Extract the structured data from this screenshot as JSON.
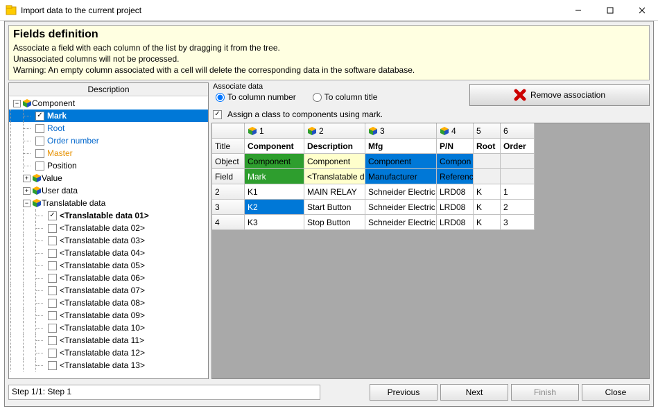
{
  "window": {
    "title": "Import data to the current project"
  },
  "instructions": {
    "heading": "Fields definition",
    "line1": "Associate a field with each column of the list by dragging it from the tree.",
    "line2": "Unassociated columns will not be processed.",
    "line3": "Warning: An empty column associated with a cell will delete the corresponding data in the software database."
  },
  "tree": {
    "header": "Description",
    "root": "Component",
    "mark": "Mark",
    "root_field": "Root",
    "order": "Order number",
    "master": "Master",
    "position": "Position",
    "value": "Value",
    "user_data": "User data",
    "translatable": "Translatable data",
    "td01": "<Translatable data 01>",
    "td02": "<Translatable data 02>",
    "td03": "<Translatable data 03>",
    "td04": "<Translatable data 04>",
    "td05": "<Translatable data 05>",
    "td06": "<Translatable data 06>",
    "td07": "<Translatable data 07>",
    "td08": "<Translatable data 08>",
    "td09": "<Translatable data 09>",
    "td10": "<Translatable data 10>",
    "td11": "<Translatable data 11>",
    "td12": "<Translatable data 12>",
    "td13": "<Translatable data 13>"
  },
  "associate": {
    "legend": "Associate data",
    "col_number": "To column number",
    "col_title": "To column title",
    "remove": "Remove association",
    "assign": "Assign a class to components using mark."
  },
  "grid": {
    "col1": "1",
    "col2": "2",
    "col3": "3",
    "col4": "4",
    "col5": "5",
    "col6": "6",
    "r_title": "Title",
    "r_object": "Object",
    "r_field": "Field",
    "t_component": "Component",
    "t_description": "Description",
    "t_mfg": "Mfg",
    "t_pn": "P/N",
    "t_root": "Root",
    "t_order": "Order",
    "o_component": "Component",
    "o_component2": "Component",
    "o_compshort": "Compon",
    "f_mark": "Mark",
    "f_trans": "<Translatable d",
    "f_manuf": "Manufacturer",
    "f_ref": "Referenc",
    "r2": "2",
    "r2_k": "K1",
    "r2_d": "MAIN RELAY",
    "r2_m": "Schneider Electric",
    "r2_p": "LRD08",
    "r2_r": "K",
    "r2_o": "1",
    "r3": "3",
    "r3_k": "K2",
    "r3_d": "Start Button",
    "r3_m": "Schneider Electric",
    "r3_p": "LRD08",
    "r3_r": "K",
    "r3_o": "2",
    "r4": "4",
    "r4_k": "K3",
    "r4_d": "Stop Button",
    "r4_m": "Schneider Electric",
    "r4_p": "LRD08",
    "r4_r": "K",
    "r4_o": "3"
  },
  "footer": {
    "status": "Step 1/1: Step 1",
    "previous": "Previous",
    "next": "Next",
    "finish": "Finish",
    "close": "Close"
  }
}
